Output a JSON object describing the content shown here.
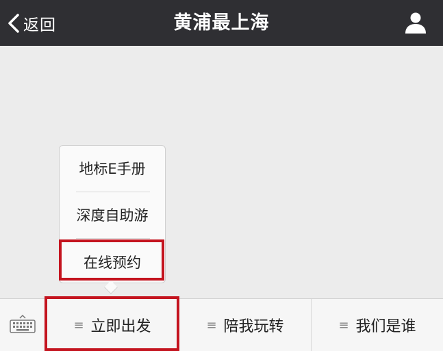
{
  "navbar": {
    "back_label": "返回",
    "title": "黄浦最上海",
    "back_icon": "chevron-left-icon",
    "profile_icon": "person-icon"
  },
  "popup_menu": {
    "items": [
      {
        "label": "地标E手册"
      },
      {
        "label": "深度自助游"
      },
      {
        "label": "在线预约"
      }
    ]
  },
  "bottom_menu": {
    "keyboard_icon": "keyboard-icon",
    "item_icon": "menu-lines-icon",
    "item_icon_glyph": "≡",
    "items": [
      {
        "label": "立即出发"
      },
      {
        "label": "陪我玩转"
      },
      {
        "label": "我们是谁"
      }
    ]
  },
  "colors": {
    "navbar_bg": "#2f2f33",
    "content_bg": "#ececec",
    "highlight": "#c4141f"
  }
}
